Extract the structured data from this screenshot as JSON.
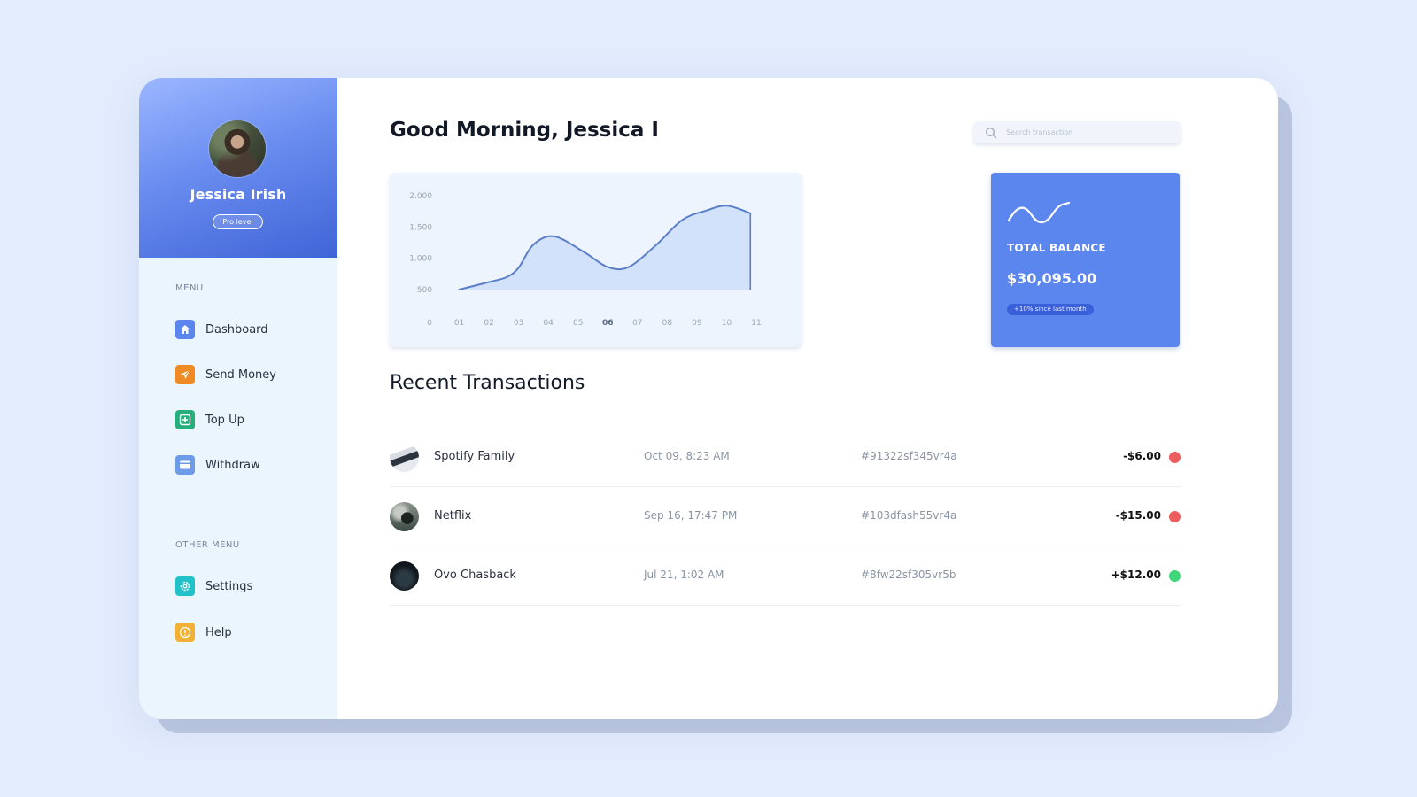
{
  "profile": {
    "name": "Jessica Irish",
    "badge": "Pro level"
  },
  "sidebar": {
    "menu_title": "MENU",
    "menu": [
      {
        "label": "Dashboard",
        "icon": "home-icon",
        "color": "#5b86ee"
      },
      {
        "label": "Send Money",
        "icon": "send-icon",
        "color": "#f08a24"
      },
      {
        "label": "Top Up",
        "icon": "plus-square-icon",
        "color": "#27ae7a"
      },
      {
        "label": "Withdraw",
        "icon": "wallet-icon",
        "color": "#6d9be8"
      }
    ],
    "other_title": "OTHER MENU",
    "other": [
      {
        "label": "Settings",
        "icon": "gear-icon",
        "color": "#22c0c9"
      },
      {
        "label": "Help",
        "icon": "info-icon",
        "color": "#f2b134"
      }
    ]
  },
  "header": {
    "greeting": "Good Morning, Jessica I",
    "search_placeholder": "Search transaction"
  },
  "chart_data": {
    "type": "area",
    "x_labels": [
      "0",
      "01",
      "02",
      "03",
      "04",
      "05",
      "06",
      "07",
      "08",
      "09",
      "10",
      "11"
    ],
    "y_ticks": [
      2000,
      1500,
      1000,
      500
    ],
    "y_tick_labels": [
      "2.000",
      "1.500",
      "1.000",
      "500"
    ],
    "highlight_x": "06",
    "x": [
      1,
      2,
      2.6,
      3,
      3.5,
      4.2,
      5.2,
      6,
      6.7,
      7.6,
      8.5,
      9.3,
      10,
      10.8
    ],
    "y": [
      500,
      620,
      700,
      850,
      1220,
      1350,
      1100,
      860,
      860,
      1200,
      1610,
      1760,
      1840,
      1720
    ],
    "ylim": [
      500,
      2000
    ],
    "grid": false
  },
  "balance": {
    "label": "TOTAL BALANCE",
    "amount": "$30,095.00",
    "change": "+10% since last month"
  },
  "transactions": {
    "title": "Recent Transactions",
    "rows": [
      {
        "name": "Spotify Family",
        "date": "Oct 09, 8:23 AM",
        "id": "#91322sf345vr4a",
        "amount": "-$6.00",
        "status_color": "#ee5d5d"
      },
      {
        "name": "Netflix",
        "date": "Sep 16, 17:47 PM",
        "id": "#103dfash55vr4a",
        "amount": "-$15.00",
        "status_color": "#ee5d5d"
      },
      {
        "name": "Ovo Chasback",
        "date": "Jul 21, 1:02 AM",
        "id": "#8fw22sf305vr5b",
        "amount": "+$12.00",
        "status_color": "#3fd67a"
      }
    ]
  }
}
